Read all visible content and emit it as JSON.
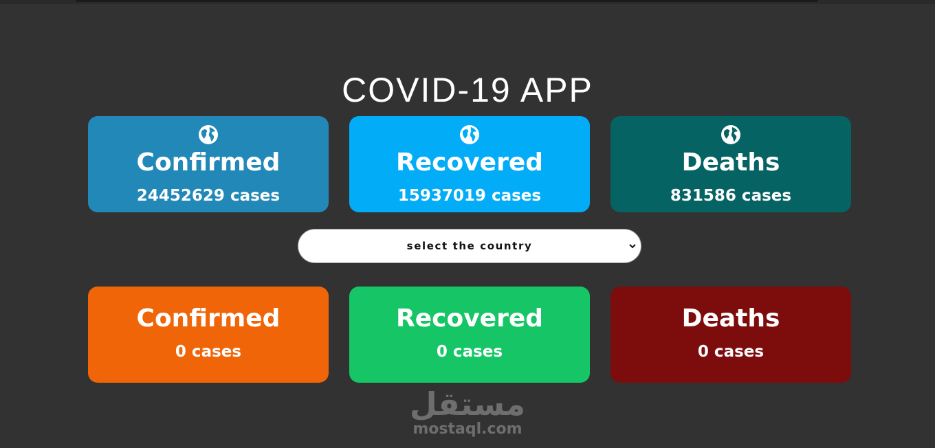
{
  "app": {
    "title": "COVID-19 APP"
  },
  "global_stats": [
    {
      "label": "Confirmed",
      "value": "24452629 cases",
      "color": "#2288b8",
      "icon": "globe-icon"
    },
    {
      "label": "Recovered",
      "value": "15937019 cases",
      "color": "#03acf6",
      "icon": "globe-icon"
    },
    {
      "label": "Deaths",
      "value": "831586 cases",
      "color": "#066363",
      "icon": "globe-icon"
    }
  ],
  "country_select": {
    "selected": "select the country"
  },
  "country_stats": [
    {
      "label": "Confirmed",
      "value": "0 cases",
      "color": "#f06508"
    },
    {
      "label": "Recovered",
      "value": "0 cases",
      "color": "#16c666"
    },
    {
      "label": "Deaths",
      "value": "0 cases",
      "color": "#7d0c0d"
    }
  ],
  "watermark": {
    "arabic": "مستقل",
    "latin": "mostaql.com"
  }
}
